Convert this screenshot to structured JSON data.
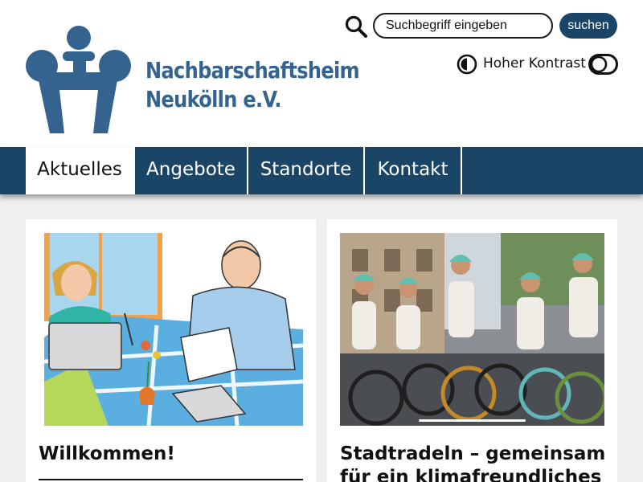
{
  "brand": {
    "name_line1": "Nachbarschaftsheim",
    "name_line2": "Neukölln e.V.",
    "color": "#35638f"
  },
  "search": {
    "placeholder": "Suchbegriff eingeben",
    "value": "",
    "button_label": "suchen"
  },
  "accessibility": {
    "contrast_label": "Hoher Kontrast",
    "contrast_enabled": false
  },
  "nav": {
    "items": [
      {
        "label": "Aktuelles",
        "active": true
      },
      {
        "label": "Angebote",
        "active": false
      },
      {
        "label": "Standorte",
        "active": false
      },
      {
        "label": "Kontakt",
        "active": false
      }
    ],
    "background": "#1b4566"
  },
  "cards": [
    {
      "title_lines": [
        "Willkommen!"
      ],
      "image": "illustration-two-people-at-table"
    },
    {
      "title_lines": [
        "Stadtradeln – gemeinsam",
        "für ein klimafreundliches"
      ],
      "image": "photo-kids-on-bicycles"
    }
  ],
  "icons": [
    "search-icon",
    "half-circle-contrast-icon",
    "toggle-switch-icon"
  ]
}
